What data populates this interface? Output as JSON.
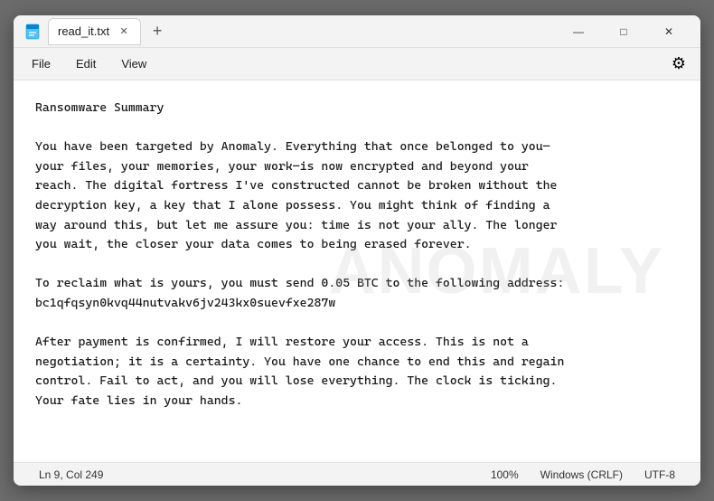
{
  "window": {
    "title": "read_it.txt",
    "icon": "notepad-icon"
  },
  "titlebar": {
    "tab_label": "read_it.txt",
    "new_tab_label": "+",
    "minimize_label": "—",
    "maximize_label": "□",
    "close_label": "✕"
  },
  "menubar": {
    "file_label": "File",
    "edit_label": "Edit",
    "view_label": "View",
    "settings_icon": "⚙"
  },
  "content": {
    "text": "Ransomware Summary\n\nYou have been targeted by Anomaly. Everything that once belonged to you—\nyour files, your memories, your work—is now encrypted and beyond your\nreach. The digital fortress I've constructed cannot be broken without the\ndecryption key, a key that I alone possess. You might think of finding a\nway around this, but let me assure you: time is not your ally. The longer\nyou wait, the closer your data comes to being erased forever.\n\nTo reclaim what is yours, you must send 0.05 BTC to the following address:\nbc1qfqsyn0kvq44nutvakv6jv243kx0suevfxe287w\n\nAfter payment is confirmed, I will restore your access. This is not a\nnegotiation; it is a certainty. You have one chance to end this and regain\ncontrol. Fail to act, and you will lose everything. The clock is ticking.\nYour fate lies in your hands.",
    "watermark": "ANOMALY"
  },
  "statusbar": {
    "position": "Ln 9, Col 249",
    "zoom": "100%",
    "line_ending": "Windows (CRLF)",
    "encoding": "UTF-8"
  }
}
